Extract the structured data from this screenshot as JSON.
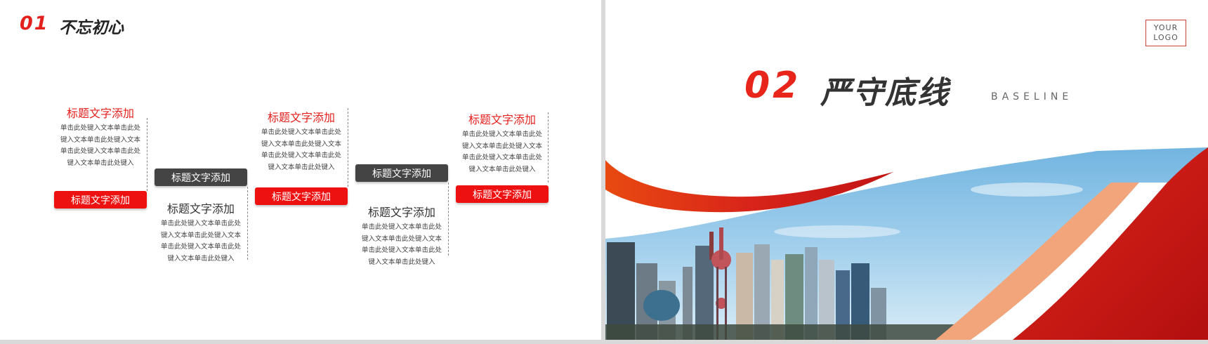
{
  "slide1": {
    "number": "01",
    "title": "不忘初心",
    "items": [
      {
        "heading": "标题文字添加",
        "desc": [
          "单击此处键入文本单击此处",
          "键入文本单击此处键入文本",
          "单击此处键入文本单击此处",
          "键入文本单击此处键入"
        ],
        "pill": "标题文字添加"
      },
      {
        "heading": "标题文字添加",
        "desc": [
          "单击此处键入文本单击此处",
          "键入文本单击此处键入文本",
          "单击此处键入文本单击此处",
          "键入文本单击此处键入"
        ],
        "pill": "标题文字添加"
      },
      {
        "heading": "标题文字添加",
        "desc": [
          "单击此处键入文本单击此处",
          "键入文本单击此处键入文本",
          "单击此处键入文本单击此处",
          "键入文本单击此处键入"
        ],
        "pill": "标题文字添加"
      },
      {
        "heading": "标题文字添加",
        "desc": [
          "单击此处键入文本单击此处",
          "键入文本单击此处键入文本",
          "单击此处键入文本单击此处",
          "键入文本单击此处键入"
        ],
        "pill": "标题文字添加"
      },
      {
        "heading": "标题文字添加",
        "desc": [
          "单击此处键入文本单击此处",
          "键入文本单击此处键入文本",
          "单击此处键入文本单击此处",
          "键入文本单击此处键入"
        ],
        "pill": "标题文字添加"
      }
    ]
  },
  "slide2": {
    "logo": [
      "YOUR",
      "LOGO"
    ],
    "number": "02",
    "title": "严守底线",
    "subtitle": "BASELINE",
    "image": "city-skyline"
  },
  "colors": {
    "accent": "#e3201c",
    "dark_pill": "#444444",
    "peach": "#f2a57a"
  }
}
